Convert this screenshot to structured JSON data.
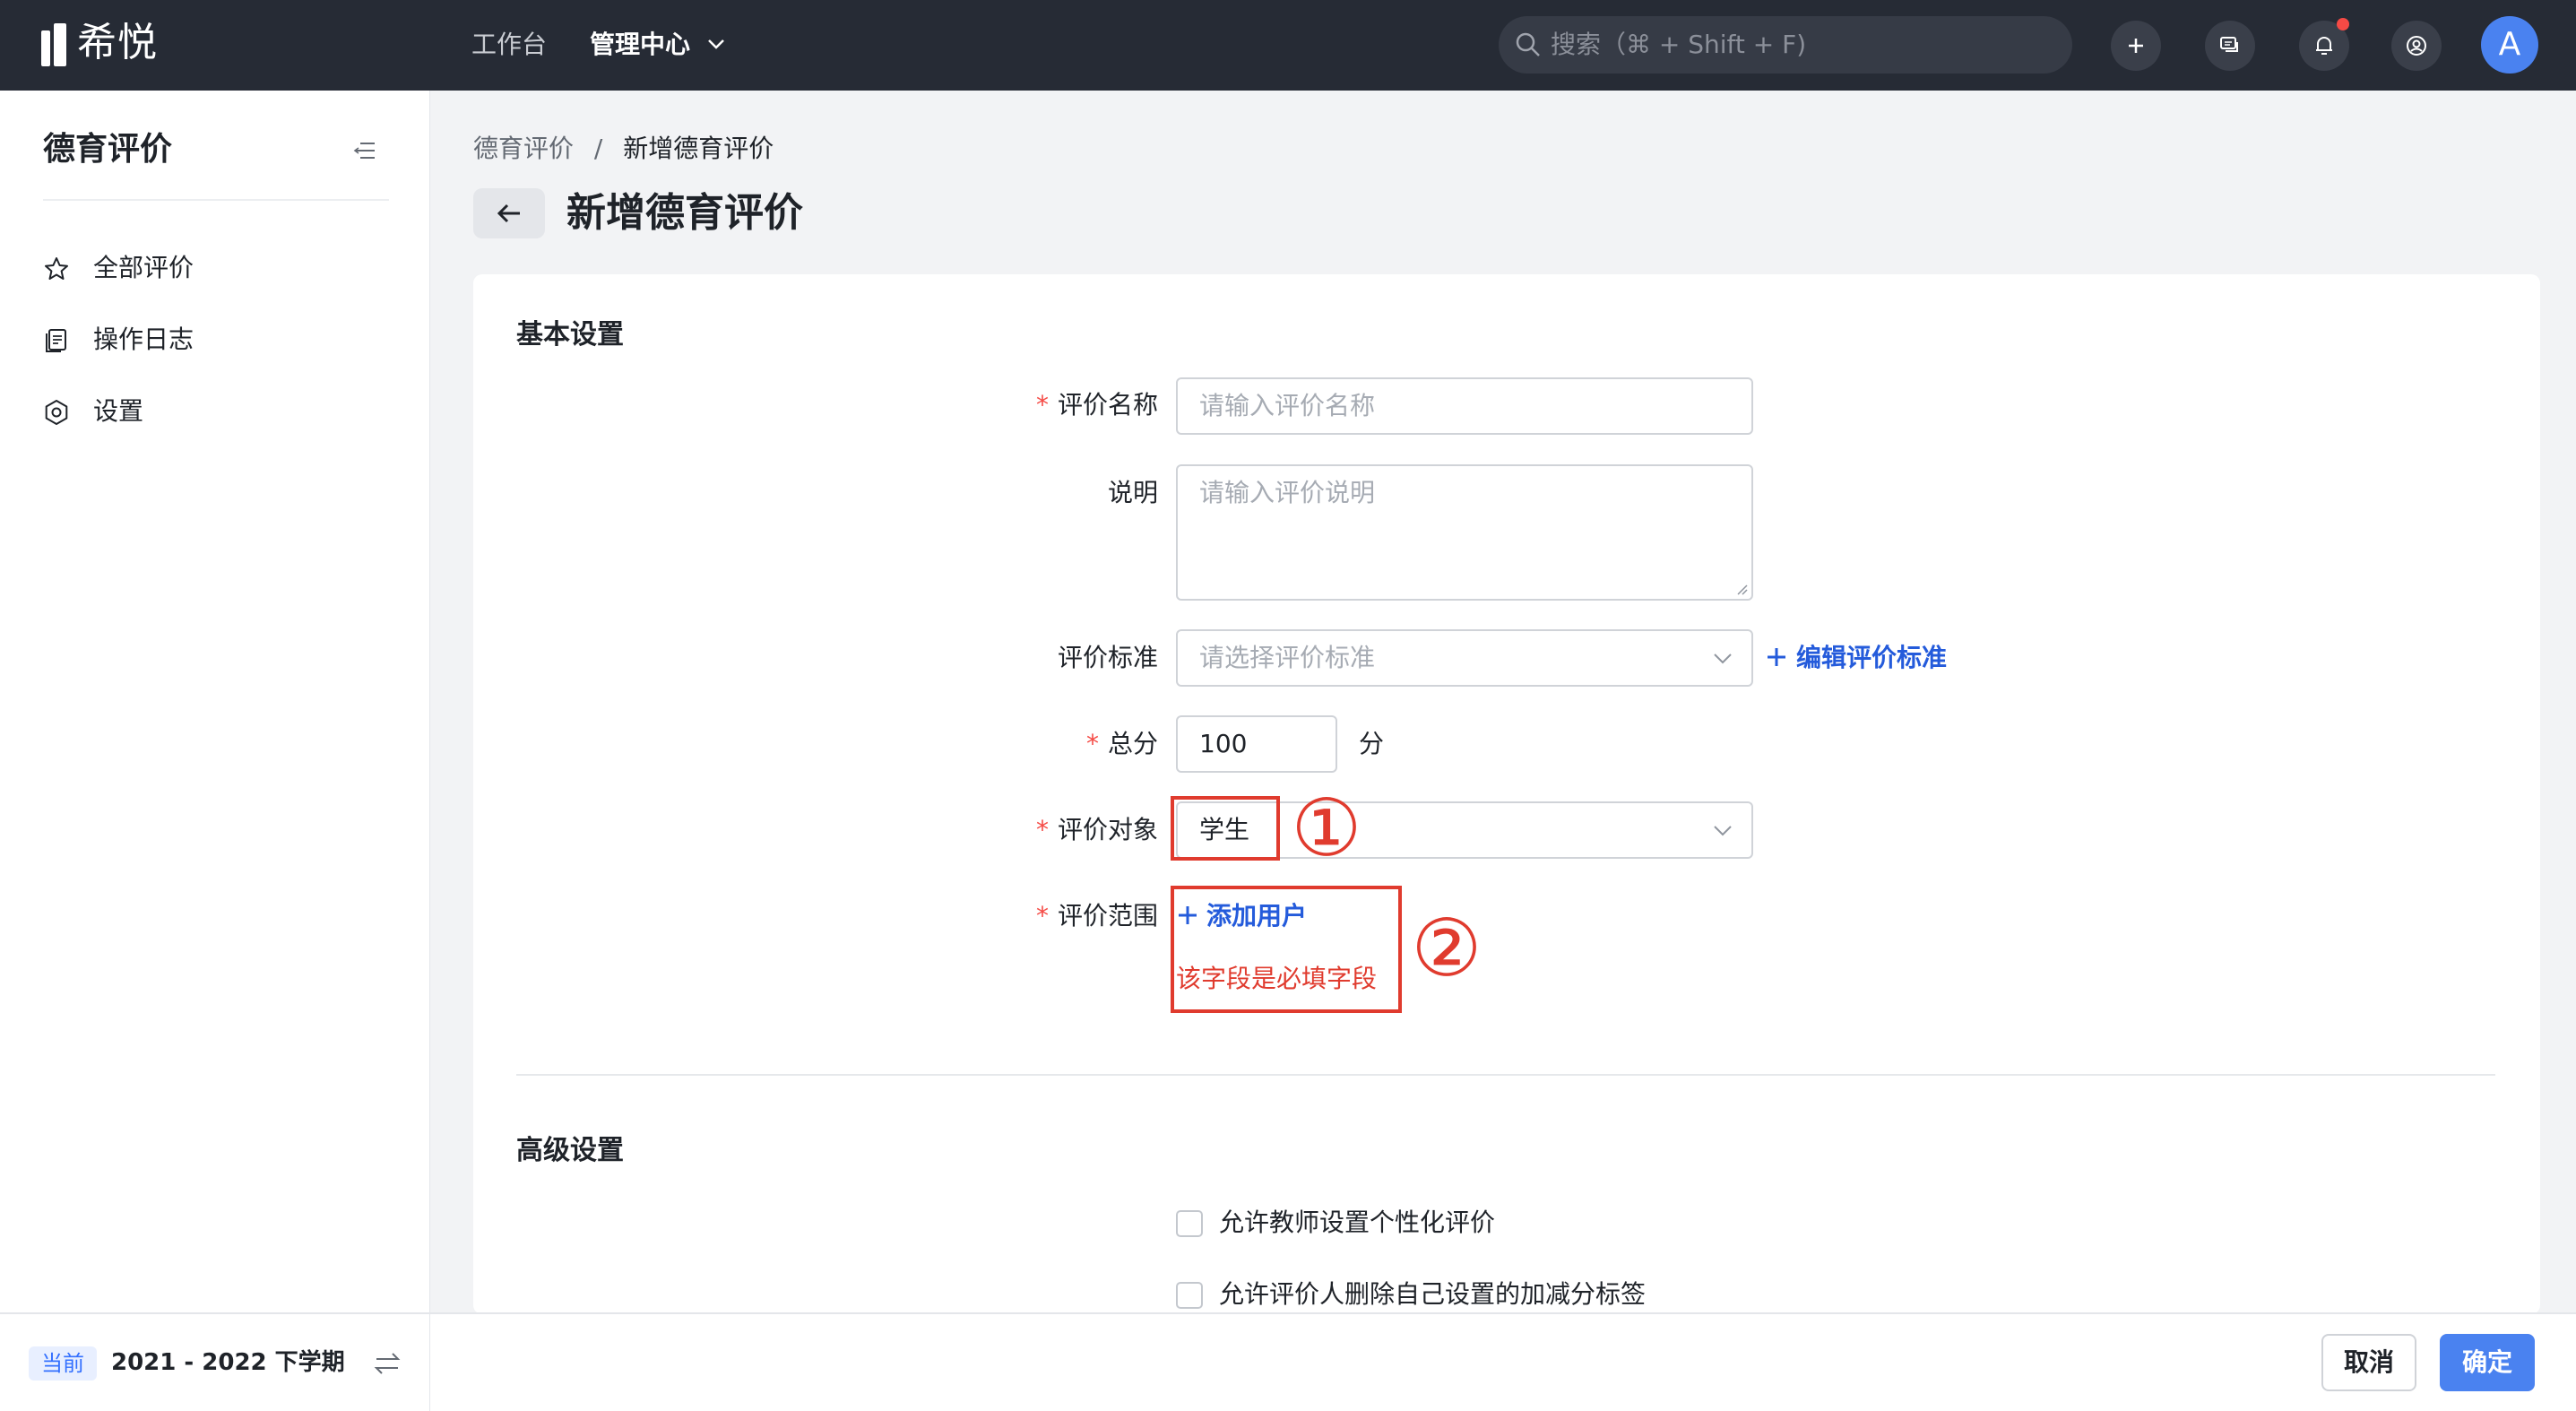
{
  "app": {
    "brand": "希悦"
  },
  "topnav": {
    "workbench": "工作台",
    "admin_center": "管理中心",
    "search_placeholder": "搜索（⌘ + Shift + F)",
    "avatar_letter": "A"
  },
  "sidebar": {
    "title": "德育评价",
    "items": [
      {
        "label": "全部评价",
        "icon": "star-icon"
      },
      {
        "label": "操作日志",
        "icon": "log-icon"
      },
      {
        "label": "设置",
        "icon": "gear-icon"
      }
    ],
    "term_badge": "当前",
    "term": "2021 - 2022 下学期"
  },
  "breadcrumb": {
    "parent": "德育评价",
    "separator": "/",
    "current": "新增德育评价"
  },
  "page_title": "新增德育评价",
  "form": {
    "basic_section": "基本设置",
    "name": {
      "label": "评价名称",
      "placeholder": "请输入评价名称",
      "required": true
    },
    "description": {
      "label": "说明",
      "placeholder": "请输入评价说明"
    },
    "standard": {
      "label": "评价标准",
      "placeholder": "请选择评价标准",
      "edit_link": "编辑评价标准"
    },
    "total": {
      "label": "总分",
      "value": "100",
      "unit": "分",
      "required": true
    },
    "target": {
      "label": "评价对象",
      "value": "学生",
      "required": true
    },
    "scope": {
      "label": "评价范围",
      "add_user": "添加用户",
      "error": "该字段是必填字段",
      "required": true
    },
    "advanced_section": "高级设置",
    "options": [
      {
        "label": "允许教师设置个性化评价",
        "checked": false
      },
      {
        "label": "允许评价人删除自己设置的加减分标签",
        "checked": false
      }
    ]
  },
  "annotations": {
    "marker1": "①",
    "marker2": "②",
    "color": "#e03b2e"
  },
  "footer": {
    "cancel": "取消",
    "confirm": "确定"
  },
  "colors": {
    "topbar": "#262b35",
    "primary": "#4a82f0",
    "link": "#245bdb",
    "error": "#f54a45"
  }
}
